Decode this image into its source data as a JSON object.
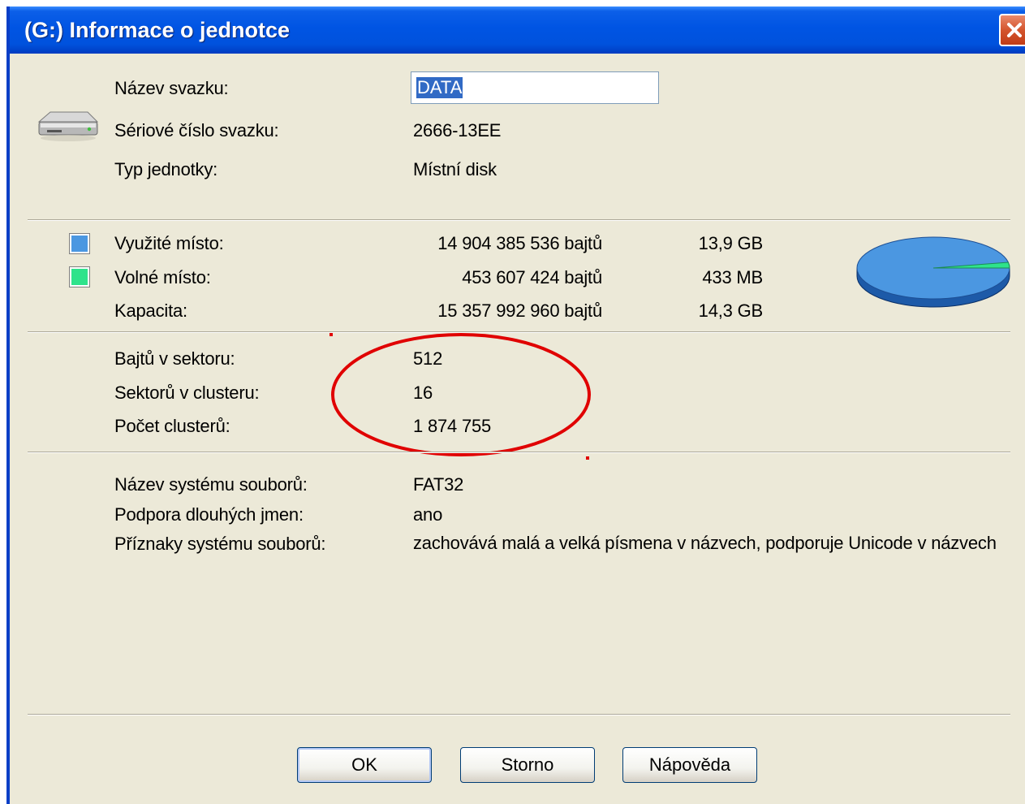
{
  "window": {
    "title": "(G:) Informace o jednotce"
  },
  "volume": {
    "name_label": "Název svazku:",
    "name_value": "DATA",
    "serial_label": "Sériové číslo svazku:",
    "serial_value": "2666-13EE",
    "type_label": "Typ jednotky:",
    "type_value": "Místní disk",
    "icon": "hard-drive-icon"
  },
  "space": {
    "used": {
      "label": "Využité místo:",
      "bytes": "14 904 385 536 bajtů",
      "size": "13,9 GB",
      "color": "#4b97e1"
    },
    "free": {
      "label": "Volné místo:",
      "bytes": "453 607 424 bajtů",
      "size": "433 MB",
      "color": "#2ee38b"
    },
    "capacity": {
      "label": "Kapacita:",
      "bytes": "15 357 992 960 bajtů",
      "size": "14,3 GB"
    },
    "used_fraction": 0.9705
  },
  "geometry": {
    "bytes_per_sector_label": "Bajtů v sektoru:",
    "bytes_per_sector_value": "512",
    "sectors_per_cluster_label": "Sektorů v clusteru:",
    "sectors_per_cluster_value": "16",
    "cluster_count_label": "Počet clusterů:",
    "cluster_count_value": "1 874 755",
    "annotation_color": "#e00000"
  },
  "filesystem": {
    "name_label": "Název systému souborů:",
    "name_value": "FAT32",
    "long_names_label": "Podpora dlouhých jmen:",
    "long_names_value": "ano",
    "flags_label": "Příznaky systému souborů:",
    "flags_value": "zachovává malá a velká písmena v názvech, podporuje Unicode v názvech"
  },
  "buttons": {
    "ok": "OK",
    "cancel": "Storno",
    "help": "Nápověda"
  }
}
